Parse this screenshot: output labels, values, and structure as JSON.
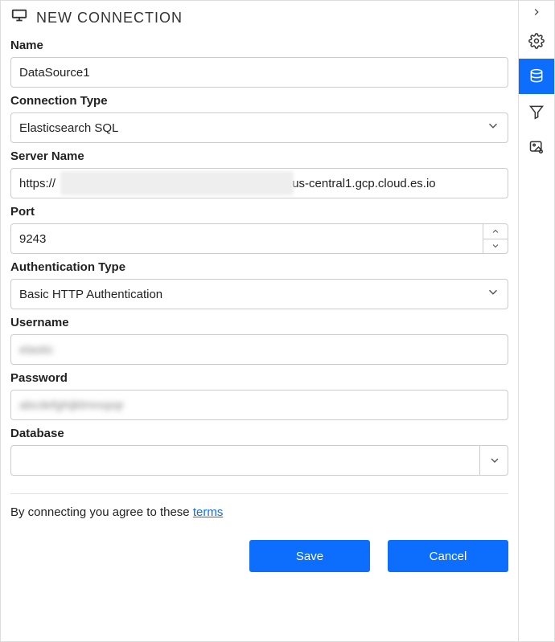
{
  "header": {
    "title": "NEW CONNECTION"
  },
  "labels": {
    "name": "Name",
    "connection_type": "Connection Type",
    "server_name": "Server Name",
    "port": "Port",
    "auth_type": "Authentication Type",
    "username": "Username",
    "password": "Password",
    "database": "Database"
  },
  "values": {
    "name": "DataSource1",
    "connection_type": "Elasticsearch SQL",
    "server_prefix": "https://",
    "server_suffix": ".us-central1.gcp.cloud.es.io",
    "port": "9243",
    "auth_type": "Basic HTTP Authentication",
    "username": "",
    "password": "",
    "database": ""
  },
  "terms": {
    "prefix": "By connecting you agree to these ",
    "link_label": "terms"
  },
  "buttons": {
    "save": "Save",
    "cancel": "Cancel"
  },
  "rail": {
    "collapse": "collapse",
    "settings": "settings",
    "datasource": "datasource",
    "filter": "filter",
    "image": "image-settings"
  }
}
